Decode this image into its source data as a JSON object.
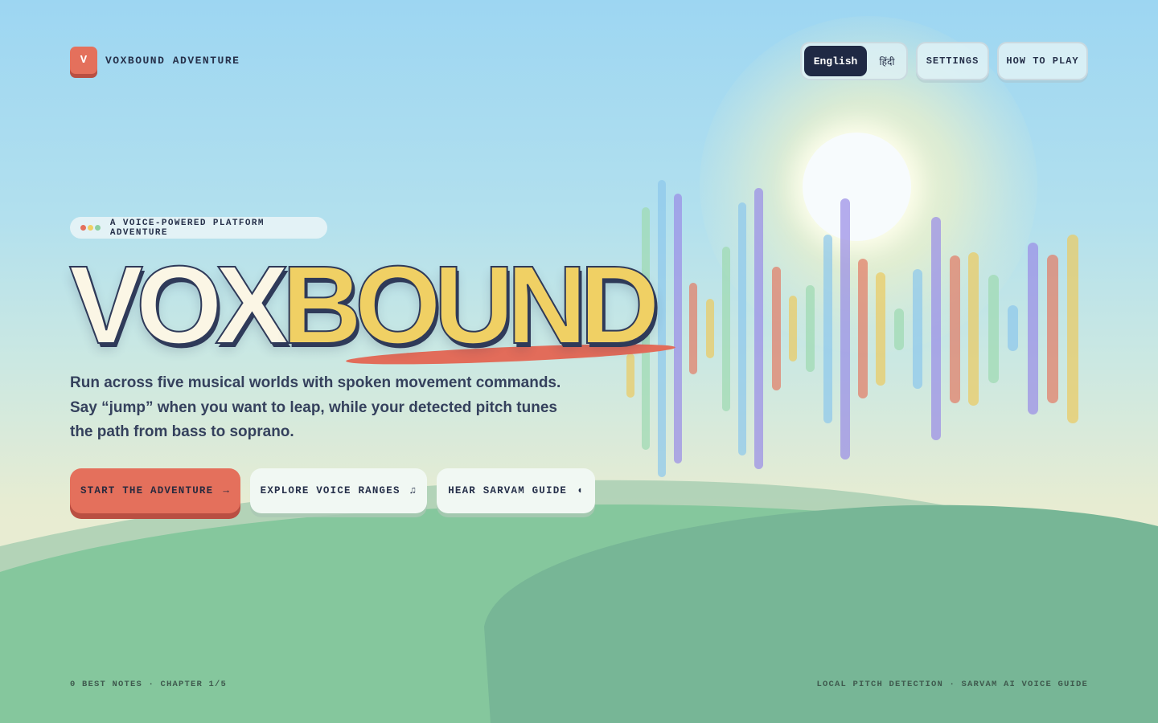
{
  "header": {
    "logo_letter": "V",
    "brand": "VOXBOUND ADVENTURE",
    "languages": [
      "English",
      "हिंदी"
    ],
    "active_language": "English",
    "settings_label": "SETTINGS",
    "how_to_play_label": "HOW TO PLAY"
  },
  "hero": {
    "tagline": "A VOICE-POWERED PLATFORM ADVENTURE",
    "tagline_dot_colors": [
      "#e4705c",
      "#f0d064",
      "#8ccfa2"
    ],
    "title_part1": "VOX",
    "title_part2": "BOUND",
    "description": "Run across five musical worlds with spoken movement commands. Say “jump” when you want to leap, while your detected pitch tunes the path from bass to soprano."
  },
  "actions": {
    "start_label": "START THE ADVENTURE",
    "start_glyph": "→",
    "explore_label": "EXPLORE VOICE RANGES",
    "explore_glyph": "♫",
    "hear_label": "HEAR SARVAM GUIDE",
    "hear_glyph": "◖"
  },
  "footer": {
    "left": "0 BEST NOTES · CHAPTER 1/5",
    "right": "LOCAL PITCH DETECTION · SARVAM AI VOICE GUIDE"
  },
  "colors": {
    "accent_coral": "#e4705c",
    "accent_yellow": "#f0d064",
    "navy": "#1f2944",
    "hill_green": "#85c79d"
  }
}
